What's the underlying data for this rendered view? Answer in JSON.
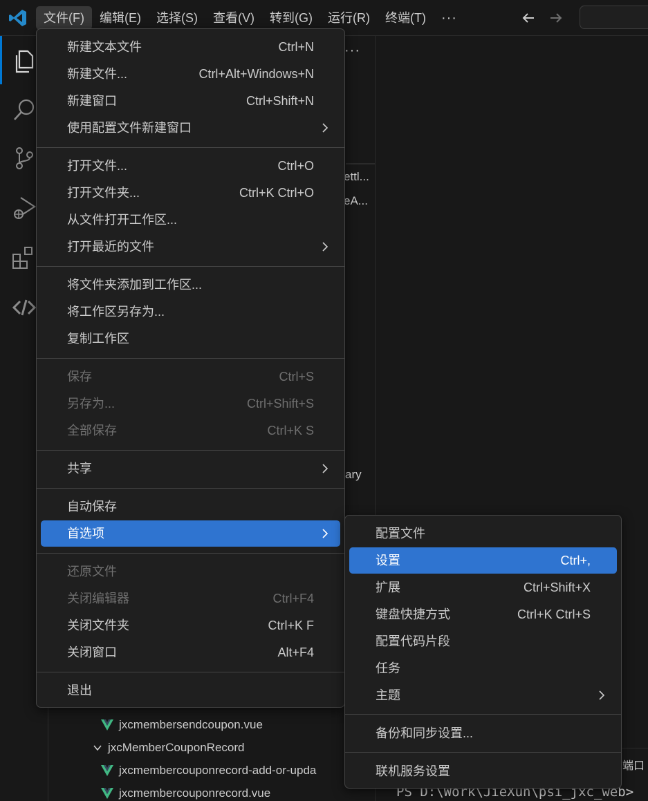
{
  "menubar": {
    "items": [
      "文件(F)",
      "编辑(E)",
      "选择(S)",
      "查看(V)",
      "转到(G)",
      "运行(R)",
      "终端(T)"
    ],
    "more": "···"
  },
  "sidebar": {
    "more": "···",
    "peek_1": "ettl...",
    "peek_2": "eA...",
    "peek_3": "ary",
    "tree": [
      "jxcmembersendcoupon.vue",
      "jxcMemberCouponRecord",
      "jxcmembercouponrecord-add-or-upda",
      "jxcmembercouponrecord.vue"
    ]
  },
  "panel": {
    "tab_label": "端口",
    "terminal_text": "PS D:\\Work\\JieXun\\psi_jxc_web>"
  },
  "file_menu": {
    "items": [
      {
        "label": "新建文本文件",
        "shortcut": "Ctrl+N"
      },
      {
        "label": "新建文件...",
        "shortcut": "Ctrl+Alt+Windows+N"
      },
      {
        "label": "新建窗口",
        "shortcut": "Ctrl+Shift+N"
      },
      {
        "label": "使用配置文件新建窗口",
        "shortcut": ""
      },
      {
        "label": "打开文件...",
        "shortcut": "Ctrl+O"
      },
      {
        "label": "打开文件夹...",
        "shortcut": "Ctrl+K Ctrl+O"
      },
      {
        "label": "从文件打开工作区...",
        "shortcut": ""
      },
      {
        "label": "打开最近的文件",
        "shortcut": ""
      },
      {
        "label": "将文件夹添加到工作区...",
        "shortcut": ""
      },
      {
        "label": "将工作区另存为...",
        "shortcut": ""
      },
      {
        "label": "复制工作区",
        "shortcut": ""
      },
      {
        "label": "保存",
        "shortcut": "Ctrl+S"
      },
      {
        "label": "另存为...",
        "shortcut": "Ctrl+Shift+S"
      },
      {
        "label": "全部保存",
        "shortcut": "Ctrl+K S"
      },
      {
        "label": "共享",
        "shortcut": ""
      },
      {
        "label": "自动保存",
        "shortcut": ""
      },
      {
        "label": "首选项",
        "shortcut": ""
      },
      {
        "label": "还原文件",
        "shortcut": ""
      },
      {
        "label": "关闭编辑器",
        "shortcut": "Ctrl+F4"
      },
      {
        "label": "关闭文件夹",
        "shortcut": "Ctrl+K F"
      },
      {
        "label": "关闭窗口",
        "shortcut": "Alt+F4"
      },
      {
        "label": "退出",
        "shortcut": ""
      }
    ]
  },
  "pref_menu": {
    "items": [
      {
        "label": "配置文件",
        "shortcut": ""
      },
      {
        "label": "设置",
        "shortcut": "Ctrl+,"
      },
      {
        "label": "扩展",
        "shortcut": "Ctrl+Shift+X"
      },
      {
        "label": "键盘快捷方式",
        "shortcut": "Ctrl+K Ctrl+S"
      },
      {
        "label": "配置代码片段",
        "shortcut": ""
      },
      {
        "label": "任务",
        "shortcut": ""
      },
      {
        "label": "主题",
        "shortcut": ""
      },
      {
        "label": "备份和同步设置...",
        "shortcut": ""
      },
      {
        "label": "联机服务设置",
        "shortcut": ""
      }
    ]
  },
  "colors": {
    "accent": "#0078d4",
    "selection": "#2f74d0",
    "vue_green": "#41b883"
  }
}
